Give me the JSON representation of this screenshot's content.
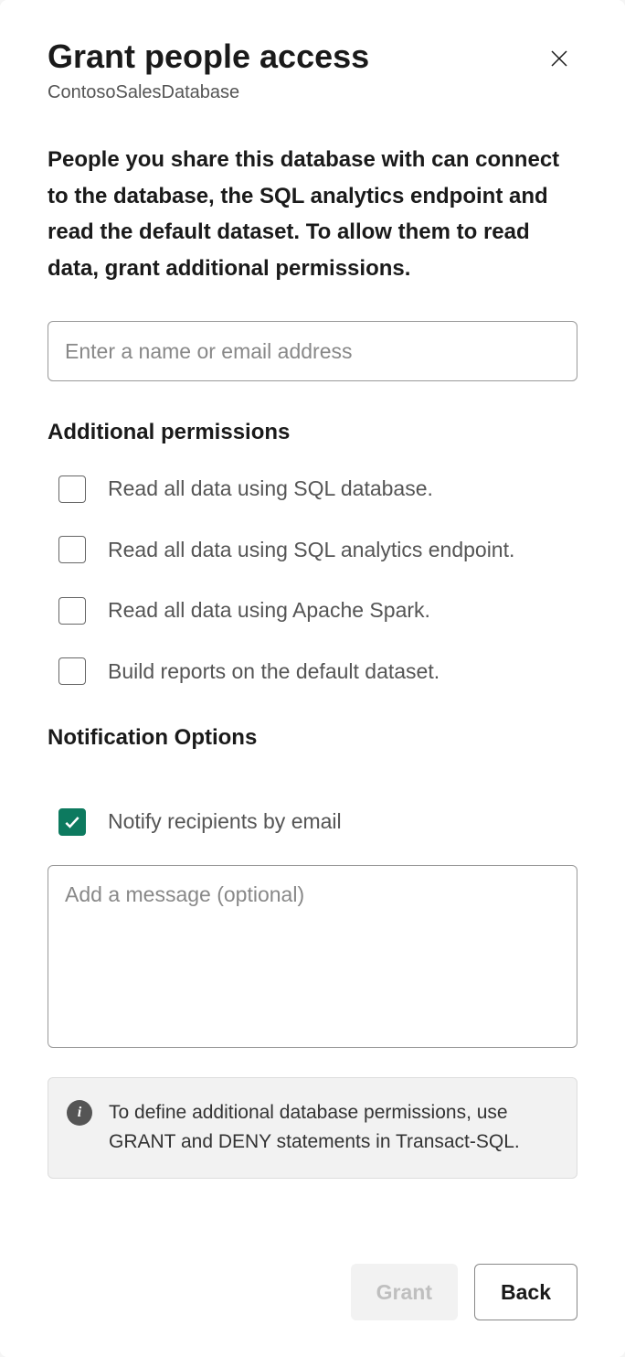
{
  "header": {
    "title": "Grant people access",
    "subtitle": "ContosoSalesDatabase"
  },
  "description": "People you share this database with can connect to the database, the SQL analytics endpoint and read the default dataset. To allow them to read data, grant additional permissions.",
  "name_input": {
    "placeholder": "Enter a name or email address",
    "value": ""
  },
  "permissions": {
    "heading": "Additional permissions",
    "items": [
      {
        "label": "Read all data using SQL database.",
        "checked": false
      },
      {
        "label": "Read all data using SQL analytics endpoint.",
        "checked": false
      },
      {
        "label": "Read all data using Apache Spark.",
        "checked": false
      },
      {
        "label": "Build reports on the default dataset.",
        "checked": false
      }
    ]
  },
  "notification": {
    "heading": "Notification Options",
    "notify": {
      "label": "Notify recipients by email",
      "checked": true
    },
    "message": {
      "placeholder": "Add a message (optional)",
      "value": ""
    }
  },
  "info_banner": "To define additional database permissions, use GRANT and DENY statements in Transact-SQL.",
  "footer": {
    "grant": "Grant",
    "back": "Back"
  }
}
